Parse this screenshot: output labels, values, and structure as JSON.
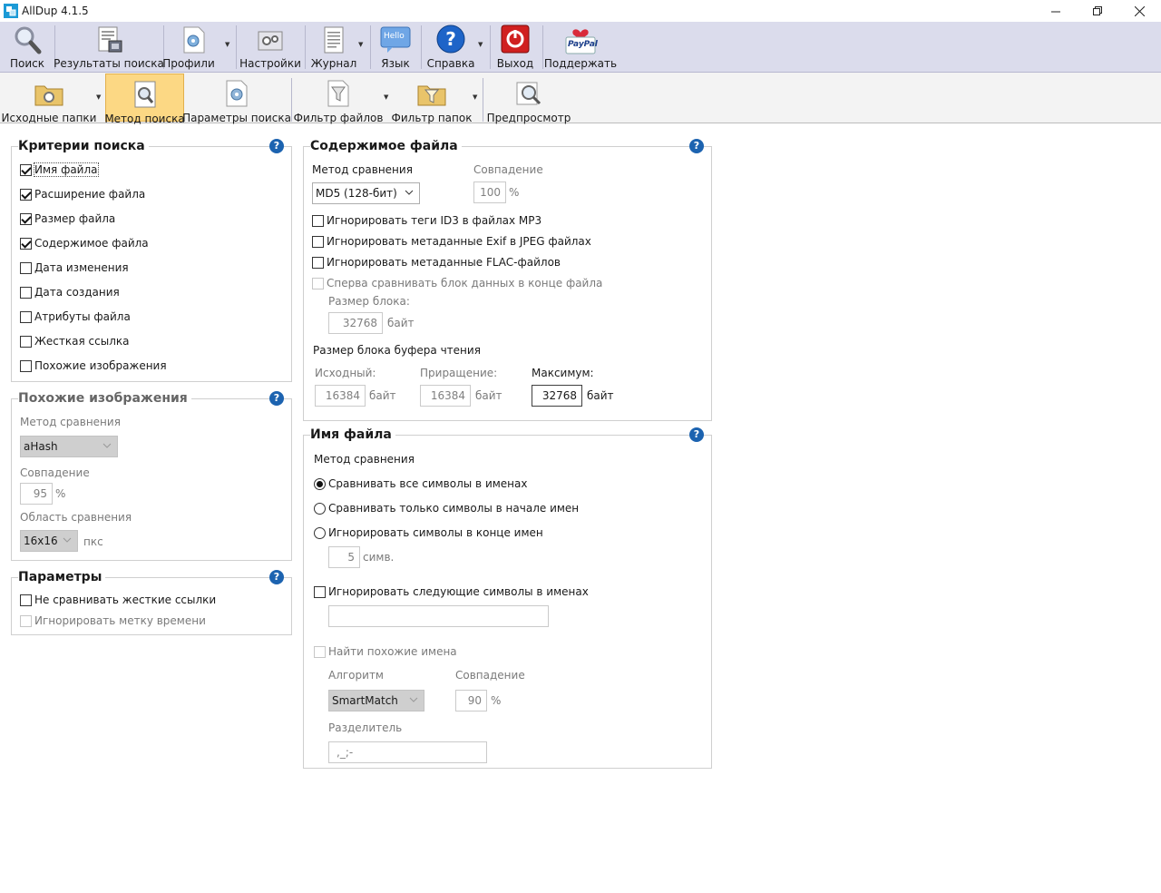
{
  "window": {
    "title": "AllDup 4.1.5"
  },
  "toolbar1": {
    "search": "Поиск",
    "results": "Результаты поиска",
    "profiles": "Профили",
    "settings": "Настройки",
    "journal": "Журнал",
    "language": "Язык",
    "language_badge": "Hello",
    "help": "Справка",
    "exit": "Выход",
    "support": "Поддержать",
    "paypal": "PayPal"
  },
  "toolbar2": {
    "source_folders": "Исходные папки",
    "search_method": "Метод поиска",
    "search_params": "Параметры поиска",
    "file_filter": "Фильтр файлов",
    "folder_filter": "Фильтр папок",
    "preview": "Предпросмотр"
  },
  "criteria": {
    "title": "Критерии поиска",
    "items": [
      {
        "label": "Имя файла",
        "checked": true
      },
      {
        "label": "Расширение файла",
        "checked": true
      },
      {
        "label": "Размер файла",
        "checked": true
      },
      {
        "label": "Содержимое файла",
        "checked": true
      },
      {
        "label": "Дата изменения",
        "checked": false
      },
      {
        "label": "Дата создания",
        "checked": false
      },
      {
        "label": "Атрибуты файла",
        "checked": false
      },
      {
        "label": "Жесткая ссылка",
        "checked": false
      },
      {
        "label": "Похожие изображения",
        "checked": false
      }
    ]
  },
  "similar_images": {
    "title": "Похожие изображения",
    "method_label": "Метод сравнения",
    "method_value": "aHash",
    "match_label": "Совпадение",
    "match_value": "95",
    "percent": "%",
    "area_label": "Область сравнения",
    "area_value": "16x16",
    "area_unit": "пкс"
  },
  "params": {
    "title": "Параметры",
    "no_hardlinks": "Не сравнивать жесткие ссылки",
    "ignore_timestamp": "Игнорировать метку времени"
  },
  "content": {
    "title": "Содержимое файла",
    "method_label": "Метод сравнения",
    "method_value": "MD5 (128-бит)",
    "match_label": "Совпадение",
    "match_value": "100",
    "percent": "%",
    "ignore_id3": "Игнорировать теги ID3 в файлах MP3",
    "ignore_exif": "Игнорировать метаданные Exif в JPEG файлах",
    "ignore_flac": "Игнорировать метаданные FLAC-файлов",
    "compare_end_first": "Сперва сравнивать блок данных в конце файла",
    "block_size_label": "Размер блока:",
    "block_size_value": "32768",
    "bytes": "байт",
    "buffer_label": "Размер блока буфера чтения",
    "initial_label": "Исходный:",
    "initial_value": "16384",
    "increment_label": "Приращение:",
    "increment_value": "16384",
    "max_label": "Максимум:",
    "max_value": "32768"
  },
  "filename": {
    "title": "Имя файла",
    "method_label": "Метод сравнения",
    "radio_all": "Сравнивать все символы в именах",
    "radio_start": "Сравнивать только символы в начале имен",
    "radio_end": "Игнорировать символы в конце имен",
    "chars_value": "5",
    "chars_unit": "симв.",
    "ignore_chars": "Игнорировать следующие символы в именах",
    "ignore_chars_value": "",
    "similar_names": "Найти похожие имена",
    "algorithm_label": "Алгоритм",
    "algorithm_value": "SmartMatch",
    "match_label": "Совпадение",
    "match_value": "90",
    "percent": "%",
    "separator_label": "Разделитель",
    "separator_value": ",_;-"
  },
  "help_symbol": "?"
}
